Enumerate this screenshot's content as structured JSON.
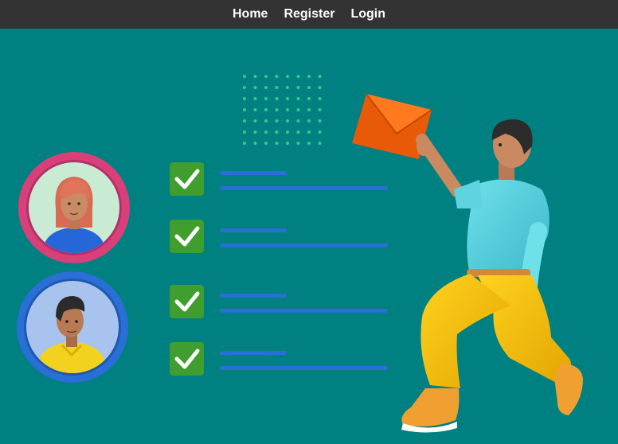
{
  "nav": {
    "items": [
      {
        "label": "Home"
      },
      {
        "label": "Register"
      },
      {
        "label": "Login"
      }
    ]
  },
  "colors": {
    "background": "#008080",
    "navbar": "#333333",
    "nav_text": "#ffffff",
    "check_green": "#3f9e2e",
    "line_blue": "#2a6fd6",
    "envelope": "#f26a10",
    "avatar_ring_pink": "#d9407a",
    "avatar_ring_blue": "#2a6fd6"
  },
  "illustration": {
    "avatars": [
      {
        "name": "woman-avatar-icon"
      },
      {
        "name": "man-avatar-icon"
      }
    ],
    "checklist_items": 4,
    "figure": "man-with-envelope-icon"
  }
}
